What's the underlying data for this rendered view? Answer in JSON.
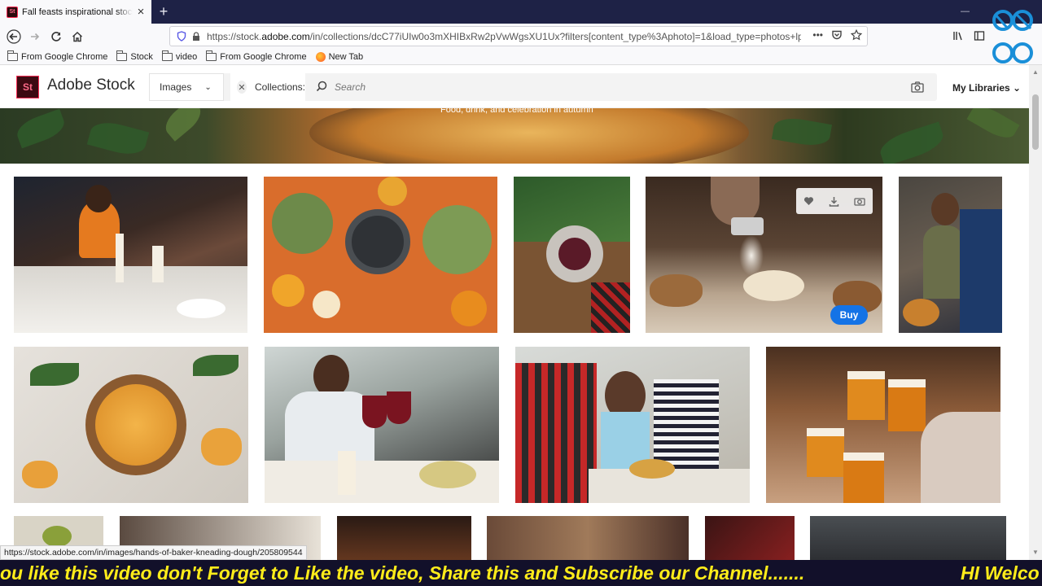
{
  "browser": {
    "tab_title": "Fall feasts inspirational stock as",
    "tab_close": "×",
    "new_tab": "+",
    "url_prefix": "https://stock.",
    "url_domain": "adobe.com",
    "url_rest": "/in/collections/dcC77iUIw0o3mXHIBxRw2pVwWgsXU1Ux?filters[content_type%3Aphoto]=1&load_type=photos+lp",
    "more_actions": "•••"
  },
  "bookmarks": [
    {
      "label": "From Google Chrome",
      "icon": "folder-icon"
    },
    {
      "label": "Stock",
      "icon": "folder-icon"
    },
    {
      "label": "video",
      "icon": "folder-icon"
    },
    {
      "label": "From Google Chrome",
      "icon": "folder-icon"
    },
    {
      "label": "New Tab",
      "icon": "firefox-icon"
    }
  ],
  "header": {
    "logo_text": "St",
    "brand": "Adobe Stock",
    "content_type": "Images",
    "collections_chip": "Collections:",
    "search_placeholder": "Search",
    "my_libraries": "My Libraries"
  },
  "hero": {
    "subtitle": "Food, drink, and celebration in autumn"
  },
  "hovered_thumb": {
    "buy_label": "Buy",
    "actions": [
      "heart-icon",
      "download-icon",
      "camera-icon"
    ]
  },
  "status_url": "https://stock.adobe.com/in/images/hands-of-baker-kneading-dough/205809544",
  "ticker": {
    "text": "ou like this video don't Forget to Like the video, Share this and Subscribe our Channel.......",
    "text2": "HI Welco"
  },
  "colors": {
    "accent": "#1473e6",
    "adobe_red": "#ff2d55",
    "ticker_text": "#ffec1a"
  }
}
